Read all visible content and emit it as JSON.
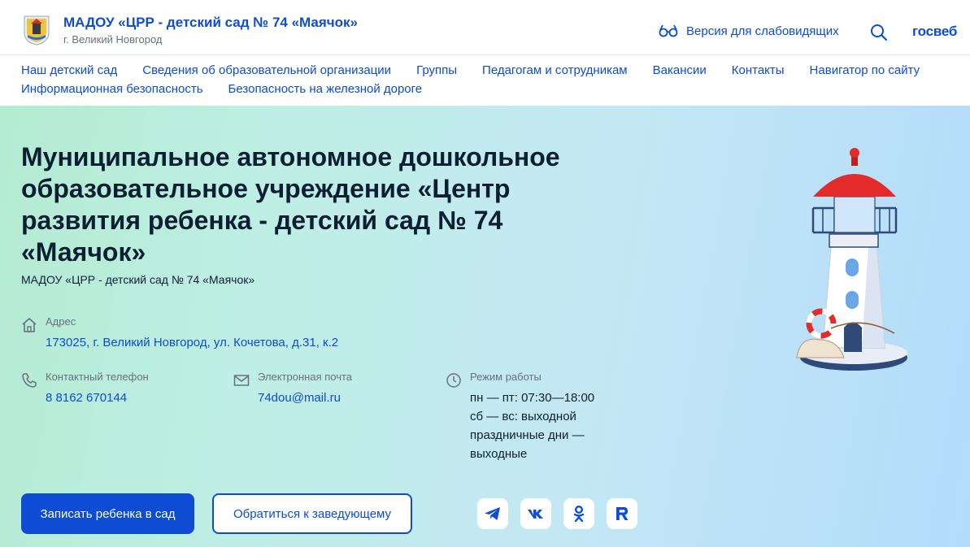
{
  "header": {
    "org_name": "МАДОУ «ЦРР - детский сад № 74 «Маячок»",
    "city": "г. Великий Новгород",
    "accessibility_label": "Версия для слабовидящих",
    "brand": "госвеб"
  },
  "nav": {
    "row1": [
      "Наш детский сад",
      "Сведения об образовательной организации",
      "Группы",
      "Педагогам и сотрудникам",
      "Вакансии",
      "Контакты",
      "Навигатор по сайту"
    ],
    "row2": [
      "Информационная безопасность",
      "Безопасность на железной дороге"
    ]
  },
  "hero": {
    "title": "Муниципальное автономное дошкольное образовательное учреждение «Центр развития ребенка - детский сад № 74 «Маячок»",
    "subtitle": "МАДОУ «ЦРР - детский сад № 74 «Маячок»",
    "address": {
      "label": "Адрес",
      "value": "173025, г. Великий Новгород, ул. Кочетова, д.31, к.2"
    },
    "phone": {
      "label": "Контактный телефон",
      "value": "8 8162 670144"
    },
    "email": {
      "label": "Электронная почта",
      "value": "74dou@mail.ru"
    },
    "hours": {
      "label": "Режим работы",
      "lines": [
        "пн — пт: 07:30—18:00",
        "сб — вс: выходной",
        "праздничные дни —",
        "выходные"
      ]
    },
    "primary_button": "Записать ребенка в сад",
    "secondary_button": "Обратиться к заведующему",
    "social": [
      "telegram-icon",
      "vk-icon",
      "odnoklassniki-icon",
      "rutube-icon"
    ]
  },
  "colors": {
    "accent": "#0d4cd3",
    "text": "#0b1f33",
    "muted": "#66727f"
  }
}
